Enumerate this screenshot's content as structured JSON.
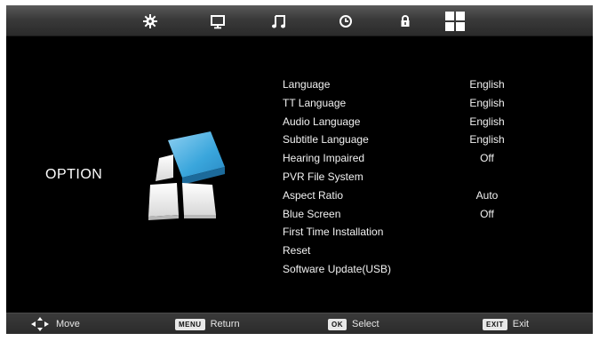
{
  "tabs": [
    {
      "id": "picture",
      "icon": "gear-icon"
    },
    {
      "id": "screen",
      "icon": "monitor-icon"
    },
    {
      "id": "sound",
      "icon": "music-note-icon"
    },
    {
      "id": "time",
      "icon": "clock-icon"
    },
    {
      "id": "lock",
      "icon": "lock-icon"
    },
    {
      "id": "option",
      "icon": "grid-icon",
      "selected": true
    }
  ],
  "page": {
    "title": "OPTION"
  },
  "menu": {
    "items": [
      {
        "label": "Language",
        "value": "English"
      },
      {
        "label": "TT Language",
        "value": "English"
      },
      {
        "label": "Audio Language",
        "value": "English"
      },
      {
        "label": "Subtitle Language",
        "value": "English"
      },
      {
        "label": "Hearing Impaired",
        "value": "Off"
      },
      {
        "label": "PVR File System",
        "value": ""
      },
      {
        "label": "Aspect Ratio",
        "value": "Auto"
      },
      {
        "label": "Blue Screen",
        "value": "Off"
      },
      {
        "label": "First Time Installation",
        "value": ""
      },
      {
        "label": "Reset",
        "value": ""
      },
      {
        "label": "Software Update(USB)",
        "value": ""
      }
    ]
  },
  "footer": {
    "move": {
      "label": "Move",
      "icon": "dpad-arrows-icon"
    },
    "return": {
      "key": "MENU",
      "label": "Return"
    },
    "select": {
      "key": "OK",
      "label": "Select"
    },
    "exit": {
      "key": "EXIT",
      "label": "Exit"
    }
  },
  "colors": {
    "background": "#000000",
    "accent_blue": "#2a90c8",
    "text": "#f2f2f2"
  }
}
